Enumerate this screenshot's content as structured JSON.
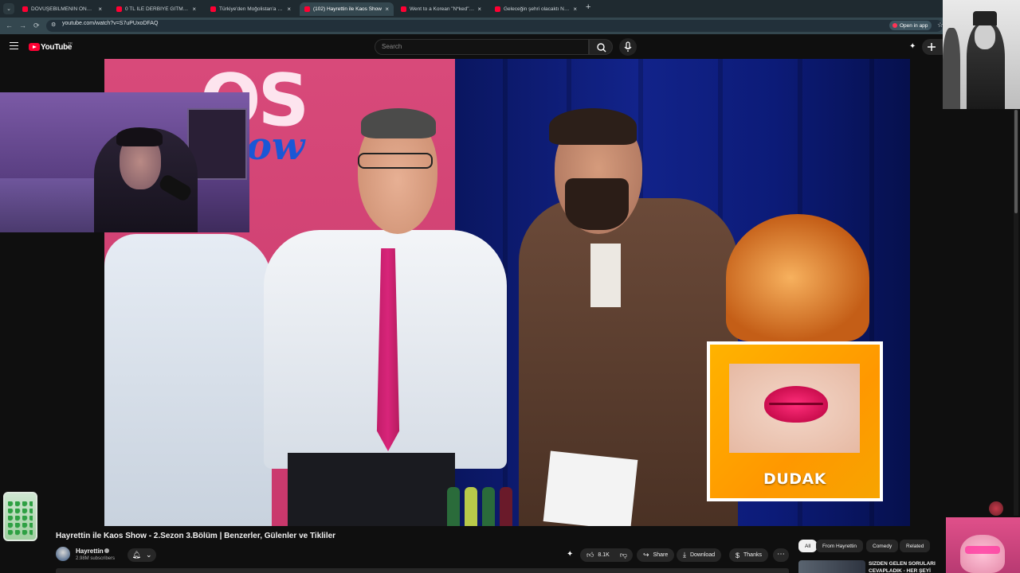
{
  "browser": {
    "tabs": [
      {
        "title": "DÖVÜŞEBİLMENİN ÖNEMİ! He",
        "active": false
      },
      {
        "title": "0 TL İLE DERBİYE GİTMEK ! ( TÜ",
        "active": false
      },
      {
        "title": "Türkiye'den Moğolistan'a Yürüş",
        "active": false
      },
      {
        "title": "(102) Hayrettin ile Kaos Show",
        "active": true
      },
      {
        "title": "Went to a Korean \"N*ked\" Bath",
        "active": false
      },
      {
        "title": "Geleceğin şehri olacaktı Neom",
        "active": false
      }
    ],
    "new_tab": "+",
    "url": "youtube.com/watch?v=S7uPUxoDFAQ",
    "open_in_app": "Open in app"
  },
  "youtube": {
    "logo": "YouTube",
    "country": "TR",
    "search_placeholder": "Search"
  },
  "player": {
    "overlay_card_label": "DUDAK"
  },
  "video": {
    "title": "Hayrettin ile Kaos Show - 2.Sezon 3.Bölüm | Benzerler, Gülenler ve Tikliler",
    "channel": "Hayrettin",
    "subscribers": "2.98M subscribers",
    "likes": "8.1K",
    "share": "Share",
    "download": "Download",
    "thanks": "Thanks"
  },
  "chips": [
    "All",
    "From Hayrettin",
    "Comedy",
    "Related"
  ],
  "recommended": {
    "title": "SİZDEN GELEN SORULARI CEVAPLADIK - HER ŞEYİ"
  },
  "colors": {
    "yt_red": "#ff0033",
    "background": "#0f0f0f",
    "card_orange": "#ff9800"
  }
}
